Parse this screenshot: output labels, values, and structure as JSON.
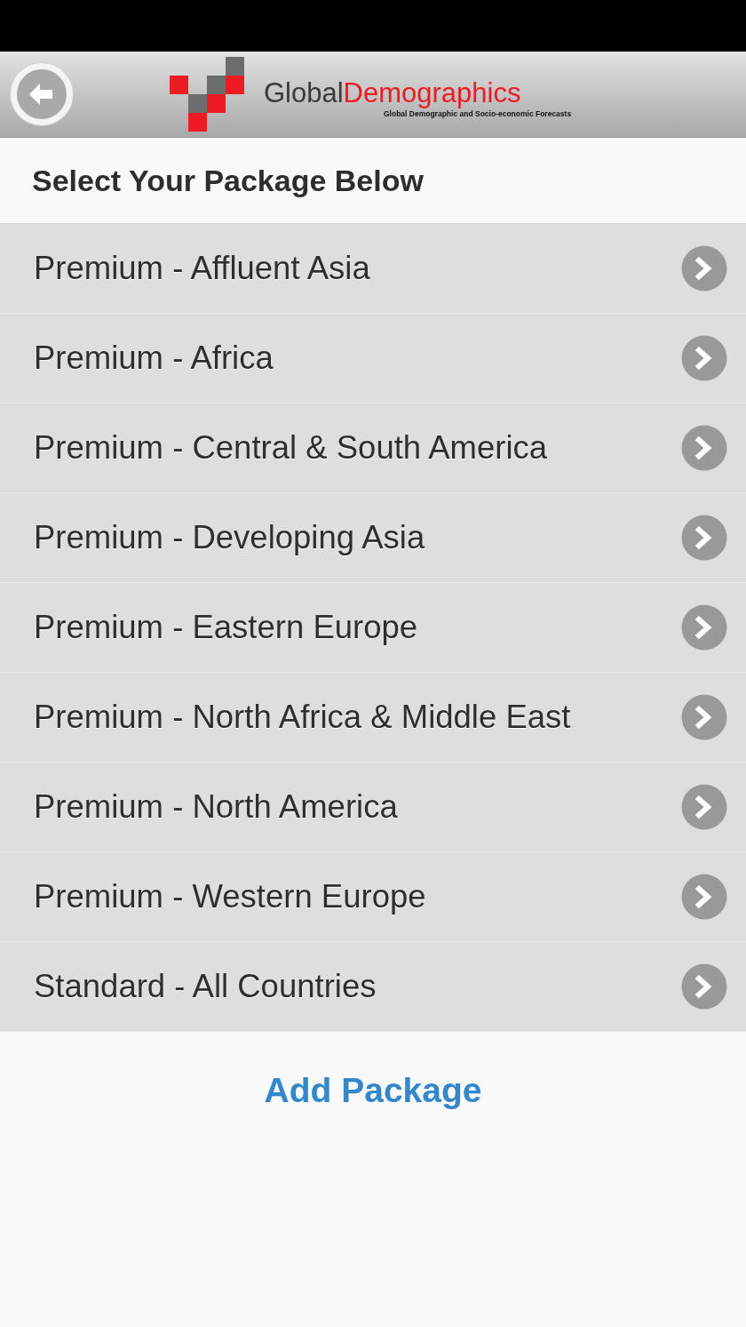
{
  "header": {
    "logo": {
      "prefix": "Global",
      "highlight": "Demographics",
      "tagline": "Global Demographic and Socio-economic Forecasts"
    }
  },
  "section_title": "Select Your Package Below",
  "packages": [
    "Premium - Affluent Asia",
    "Premium - Africa",
    "Premium - Central & South America",
    "Premium - Developing Asia",
    "Premium - Eastern Europe",
    "Premium - North Africa & Middle East",
    "Premium - North America",
    "Premium - Western Europe",
    "Standard - All Countries"
  ],
  "add_button": "Add Package"
}
